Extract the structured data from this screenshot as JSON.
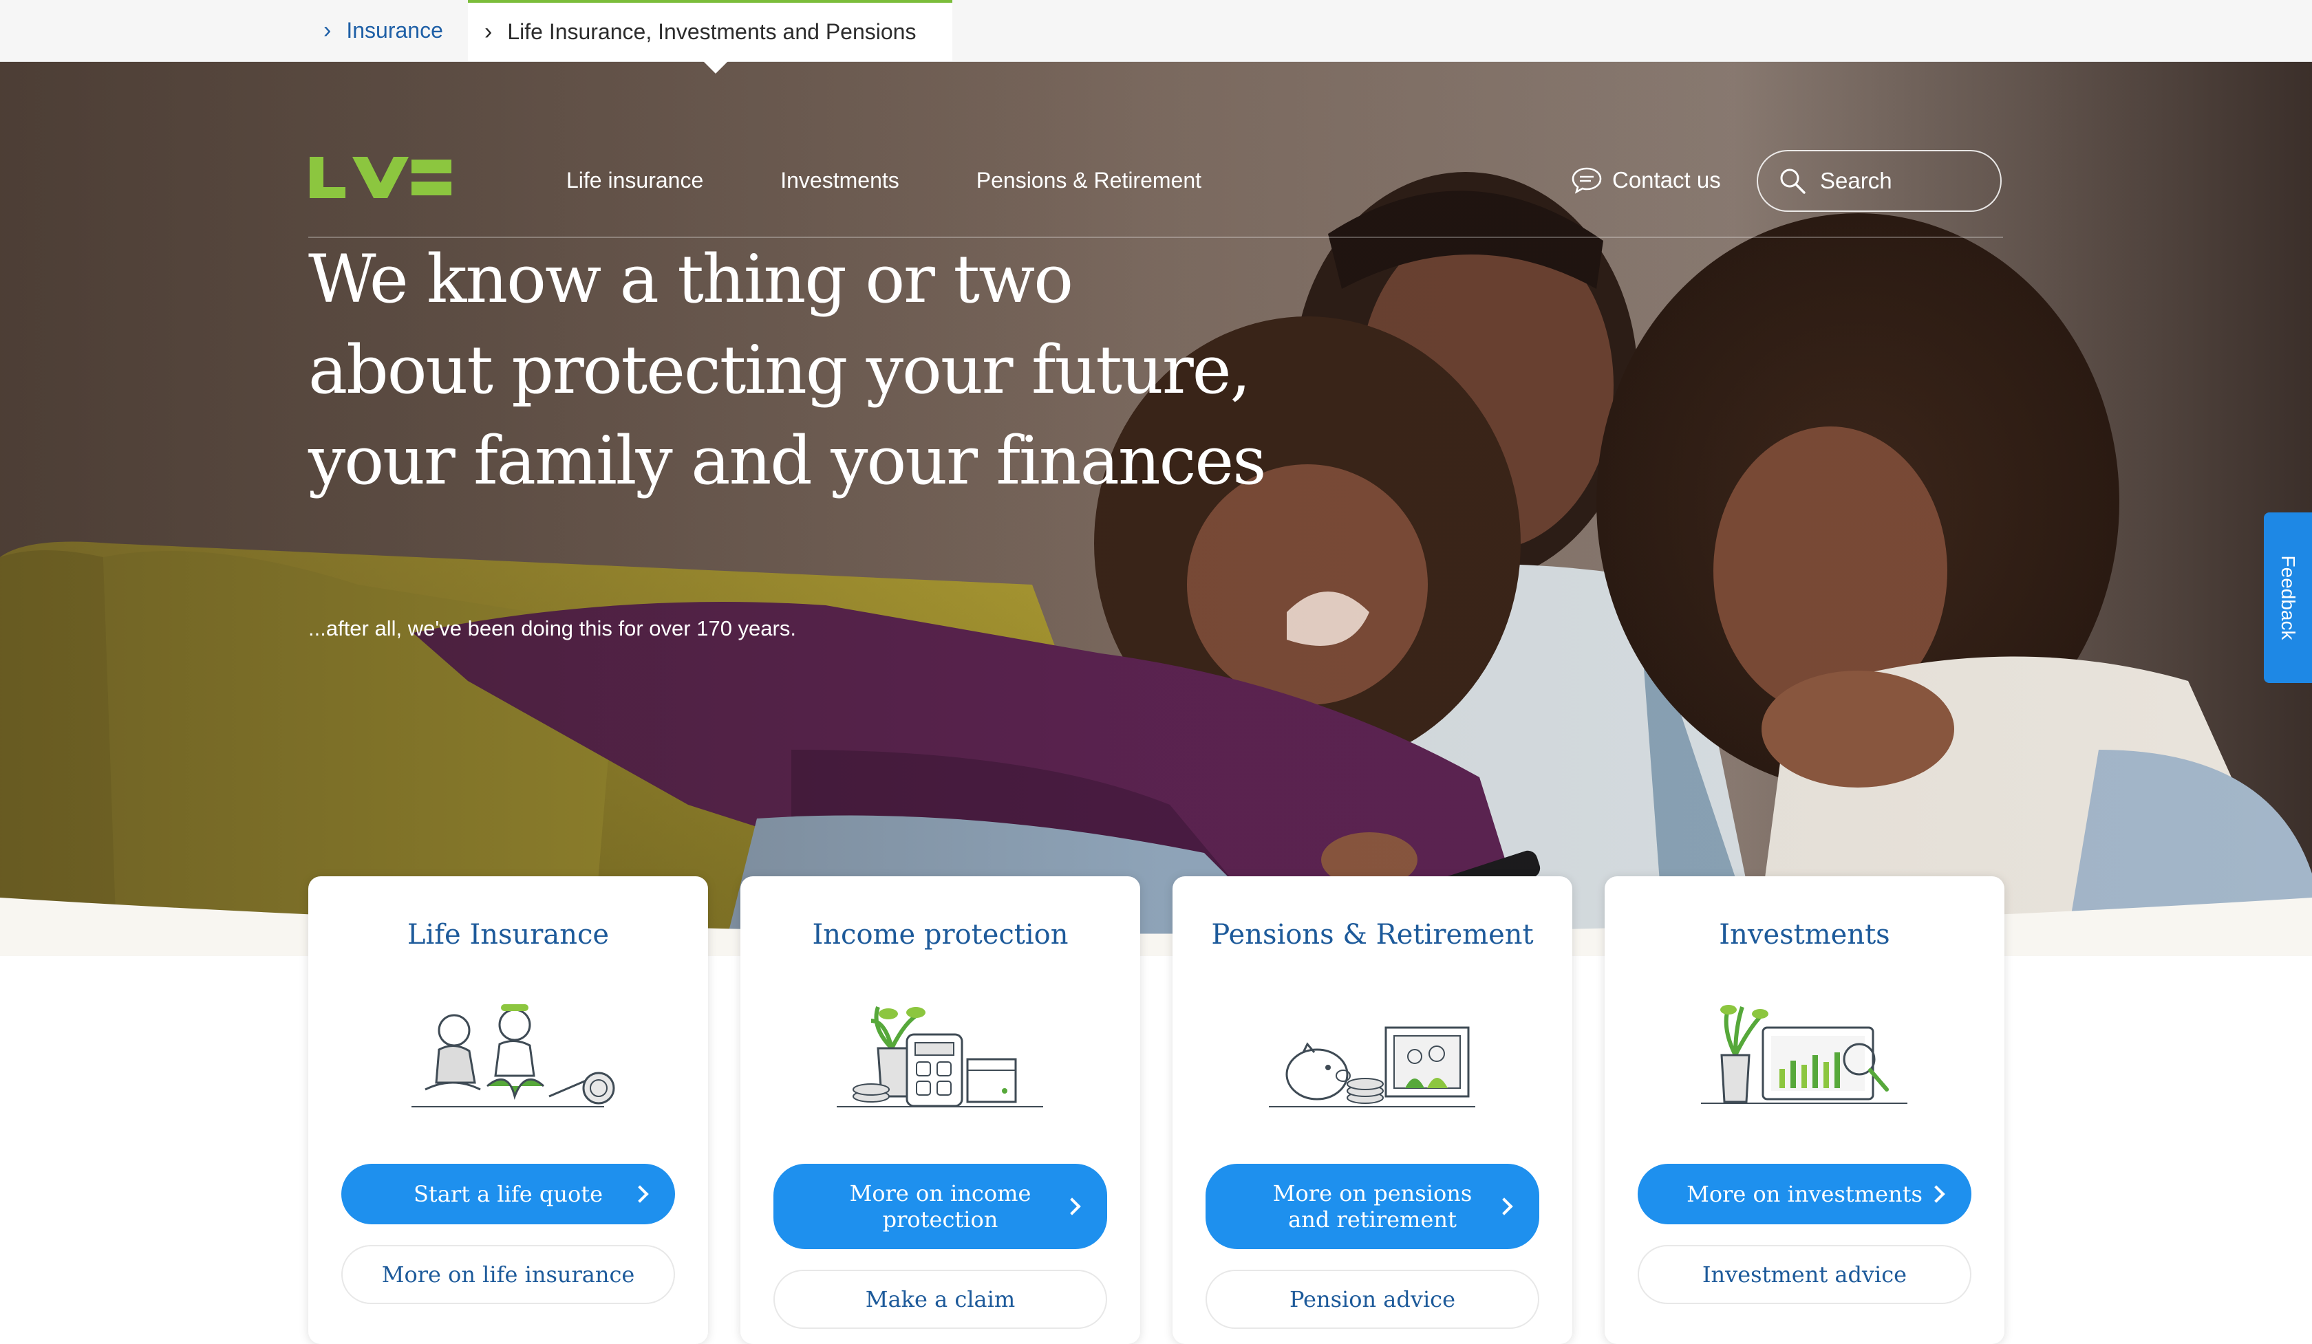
{
  "breadcrumb": {
    "items": [
      {
        "label": "Insurance"
      },
      {
        "label": "Life Insurance, Investments and Pensions"
      }
    ]
  },
  "nav": {
    "logo_alt": "LV=",
    "links": [
      {
        "label": "Life insurance"
      },
      {
        "label": "Investments"
      },
      {
        "label": "Pensions & Retirement"
      }
    ],
    "contact_label": "Contact us",
    "search_placeholder": "Search"
  },
  "hero": {
    "headline_lines": [
      "We know a thing or two",
      "about protecting your future,",
      "your family and your finances"
    ],
    "subline": "...after all, we've been doing this for over 170 years."
  },
  "feedback_label": "Feedback",
  "cards": [
    {
      "title": "Life Insurance",
      "illustration": "people-yoga-illustration",
      "primary_label": "Start a life quote",
      "secondary_label": "More on life insurance"
    },
    {
      "title": "Income protection",
      "illustration": "calculator-coins-illustration",
      "primary_label": "More on income protection",
      "secondary_label": "Make a claim"
    },
    {
      "title": "Pensions & Retirement",
      "illustration": "piggy-bank-photo-illustration",
      "primary_label": "More on pensions and retirement",
      "secondary_label": "Pension advice"
    },
    {
      "title": "Investments",
      "illustration": "laptop-chart-illustration",
      "primary_label": "More on investments",
      "secondary_label": "Investment advice"
    }
  ],
  "colors": {
    "brand_green": "#7bbd3a",
    "link_blue": "#1e5fa6",
    "title_blue": "#1d5a9a",
    "button_blue": "#1e90ee",
    "feedback_blue": "#1e88e5"
  }
}
